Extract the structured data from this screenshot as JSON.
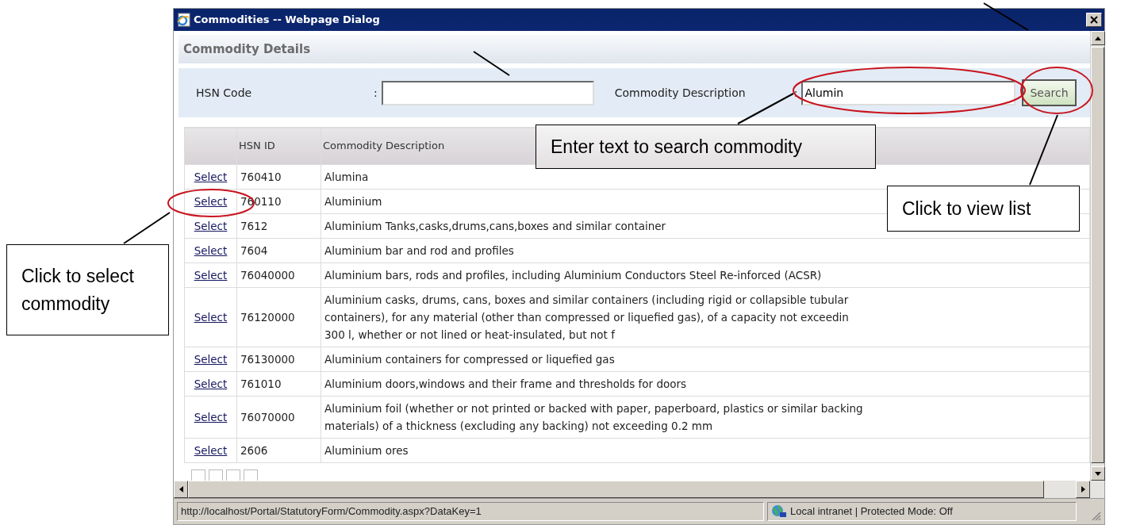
{
  "dialog": {
    "title": "Commodities -- Webpage Dialog"
  },
  "section_title": "Commodity Details",
  "search": {
    "fields": [
      {
        "label": "HSN Code",
        "separator": ":"
      },
      {
        "label": "Commodity Description",
        "separator": ":",
        "value": "Alumin"
      }
    ],
    "button": "Search"
  },
  "table": {
    "columns": [
      "HSN ID",
      "Commodity Description"
    ],
    "rows": [
      {
        "action": "Select",
        "hsn_id": "760410",
        "description": [
          "Alumina"
        ]
      },
      {
        "action": "Select",
        "hsn_id": "760110",
        "description": [
          "Aluminium"
        ]
      },
      {
        "action": "Select",
        "hsn_id": "7612",
        "description": [
          "Aluminium Tanks,casks,drums,cans,boxes and similar container"
        ]
      },
      {
        "action": "Select",
        "hsn_id": "7604",
        "description": [
          "Aluminium bar and rod and profiles"
        ]
      },
      {
        "action": "Select",
        "hsn_id": "76040000",
        "description": [
          "Aluminium bars, rods and profiles, including Aluminium Conductors Steel Re-inforced (ACSR)"
        ]
      },
      {
        "action": "Select",
        "hsn_id": "76120000",
        "description": [
          "Aluminium casks, drums, cans, boxes and similar containers (including rigid or collapsible tubular",
          "containers), for any material (other than compressed or liquefied gas), of a capacity not exceedin",
          "300 l, whether or not lined or heat-insulated, but not f"
        ]
      },
      {
        "action": "Select",
        "hsn_id": "76130000",
        "description": [
          "Aluminium containers for compressed or liquefied gas"
        ]
      },
      {
        "action": "Select",
        "hsn_id": "761010",
        "description": [
          "Aluminium doors,windows and their frame and thresholds for doors"
        ]
      },
      {
        "action": "Select",
        "hsn_id": "76070000",
        "description": [
          "Aluminium foil (whether or not printed or backed with paper, paperboard, plastics or similar backing",
          "materials) of a thickness (excluding any backing) not exceeding 0.2 mm"
        ]
      },
      {
        "action": "Select",
        "hsn_id": "2606",
        "description": [
          "Aluminium ores"
        ]
      }
    ]
  },
  "status_bar": {
    "url": "http://localhost/Portal/StatutoryForm/Commodity.aspx?DataKey=1",
    "zone": "Local intranet | Protected Mode: Off"
  },
  "annotations": [
    {
      "text": "Enter text to search commodity"
    },
    {
      "text": "Click to view list"
    },
    {
      "text": "Click to select commodity"
    }
  ]
}
